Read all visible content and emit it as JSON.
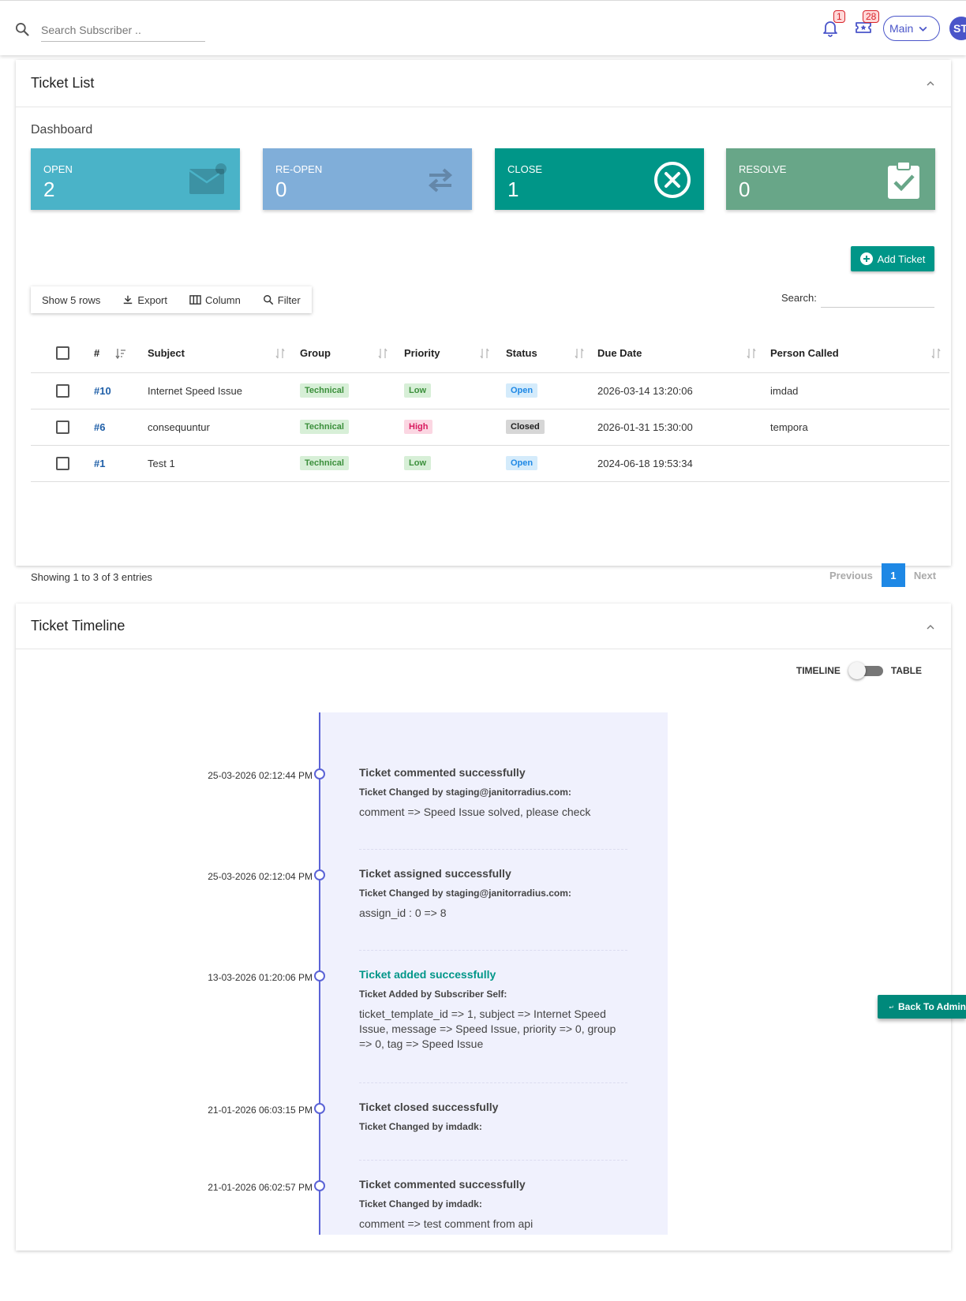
{
  "topbar": {
    "search_placeholder": "Search Subscriber ..",
    "notifications_count": "1",
    "tickets_count": "28",
    "main_label": "Main",
    "avatar_initials": "ST"
  },
  "ticket_list": {
    "title": "Ticket List",
    "dashboard_label": "Dashboard",
    "stats": [
      {
        "label": "OPEN",
        "value": "2",
        "color": "#4ab3c8",
        "icon": "mail-icon"
      },
      {
        "label": "RE-OPEN",
        "value": "0",
        "color": "#80aed9",
        "icon": "swap-arrows-icon"
      },
      {
        "label": "CLOSE",
        "value": "1",
        "color": "#009688",
        "icon": "close-circle-icon"
      },
      {
        "label": "RESOLVE",
        "value": "0",
        "color": "#68a688",
        "icon": "clipboard-check-icon"
      }
    ],
    "add_ticket_label": "Add Ticket",
    "toolbar": {
      "show_rows": "Show 5 rows",
      "export": "Export",
      "column": "Column",
      "filter": "Filter"
    },
    "search_label": "Search:",
    "columns": [
      "#",
      "Subject",
      "Group",
      "Priority",
      "Status",
      "Due Date",
      "Person Called"
    ],
    "rows": [
      {
        "id": "#10",
        "subject": "Internet Speed Issue",
        "group": "Technical",
        "priority": "Low",
        "status": "Open",
        "due": "2026-03-14 13:20:06",
        "person": "imdad"
      },
      {
        "id": "#6",
        "subject": "consequuntur",
        "group": "Technical",
        "priority": "High",
        "status": "Closed",
        "due": "2026-01-31 15:30:00",
        "person": "tempora"
      },
      {
        "id": "#1",
        "subject": "Test 1",
        "group": "Technical",
        "priority": "Low",
        "status": "Open",
        "due": "2024-06-18 19:53:34",
        "person": ""
      }
    ],
    "showing": "Showing 1 to 3 of 3 entries",
    "pager": {
      "previous": "Previous",
      "current": "1",
      "next": "Next"
    }
  },
  "timeline": {
    "title": "Ticket Timeline",
    "toggle_left": "TIMELINE",
    "toggle_right": "TABLE",
    "entries": [
      {
        "date": "25-03-2026 02:12:44 PM",
        "title": "Ticket commented successfully",
        "by": "Ticket Changed by staging@janitorradius.com:",
        "msg": "comment => Speed Issue solved, please check"
      },
      {
        "date": "25-03-2026 02:12:04 PM",
        "title": "Ticket assigned successfully",
        "by": "Ticket Changed by staging@janitorradius.com:",
        "msg": "assign_id : 0 => 8"
      },
      {
        "date": "13-03-2026 01:20:06 PM",
        "title": "Ticket added successfully",
        "by": "Ticket Added by Subscriber Self:",
        "msg": "ticket_template_id => 1, subject => Internet Speed Issue, message => Speed Issue, priority => 0, group => 0, tag => Speed Issue"
      },
      {
        "date": "21-01-2026 06:03:15 PM",
        "title": "Ticket closed successfully",
        "by": "Ticket Changed by imdadk:",
        "msg": ""
      },
      {
        "date": "21-01-2026 06:02:57 PM",
        "title": "Ticket commented successfully",
        "by": "Ticket Changed by imdadk:",
        "msg": "comment => test comment from api"
      }
    ]
  },
  "back_to_admin_label": "Back To Admin"
}
